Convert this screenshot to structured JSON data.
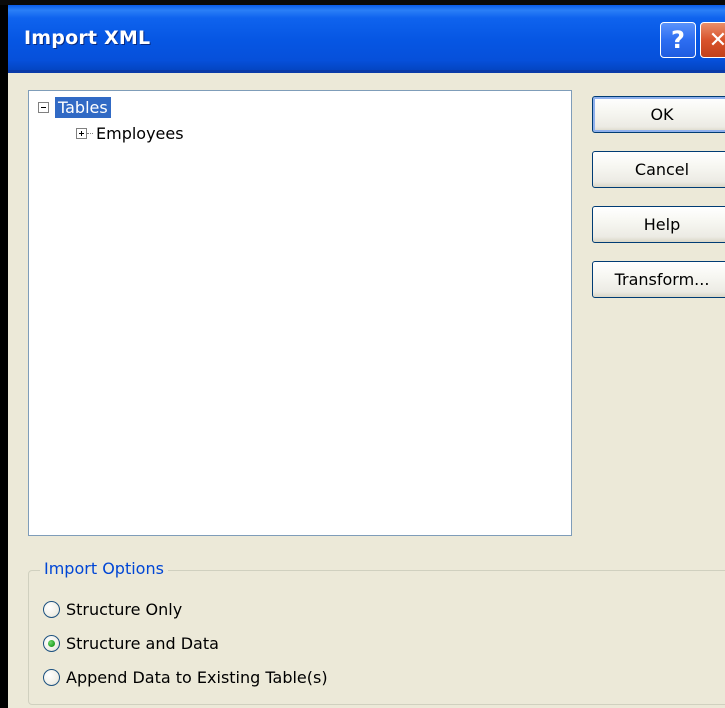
{
  "window": {
    "title": "Import XML",
    "help_glyph": "?",
    "close_glyph": "✕"
  },
  "tree": {
    "root_label": "Tables",
    "children": [
      {
        "label": "Employees"
      }
    ]
  },
  "buttons": {
    "ok": "OK",
    "cancel": "Cancel",
    "help": "Help",
    "transform": "Transform..."
  },
  "import_options": {
    "legend": "Import Options",
    "options": [
      {
        "label": "Structure Only",
        "checked": false
      },
      {
        "label": "Structure and Data",
        "checked": true
      },
      {
        "label": "Append Data to Existing Table(s)",
        "checked": false
      }
    ]
  },
  "colors": {
    "titlebar": "#0656e3",
    "selection": "#316ac5",
    "legend_text": "#0046d5",
    "radio_checked": "#21a121"
  }
}
